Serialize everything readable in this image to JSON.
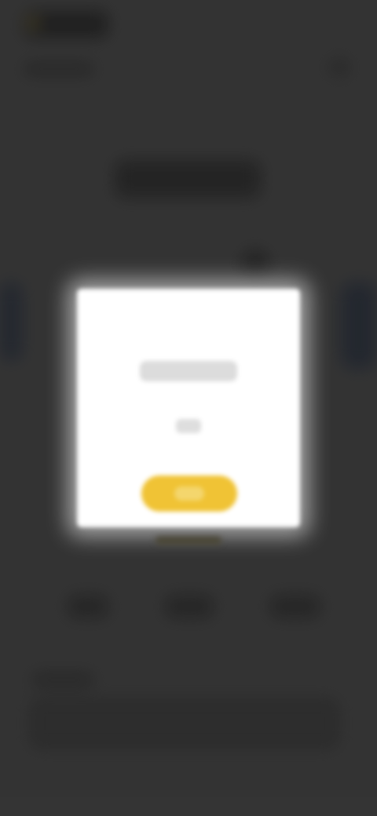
{
  "background_app": {
    "state": "blurred",
    "tabs": [
      {
        "label": ""
      },
      {
        "label": ""
      },
      {
        "label": ""
      }
    ]
  },
  "modal": {
    "title": "",
    "button_label": ""
  },
  "colors": {
    "overlay": "#3d3d3d",
    "modal_background": "#ffffff",
    "primary_button": "#f0c335"
  }
}
